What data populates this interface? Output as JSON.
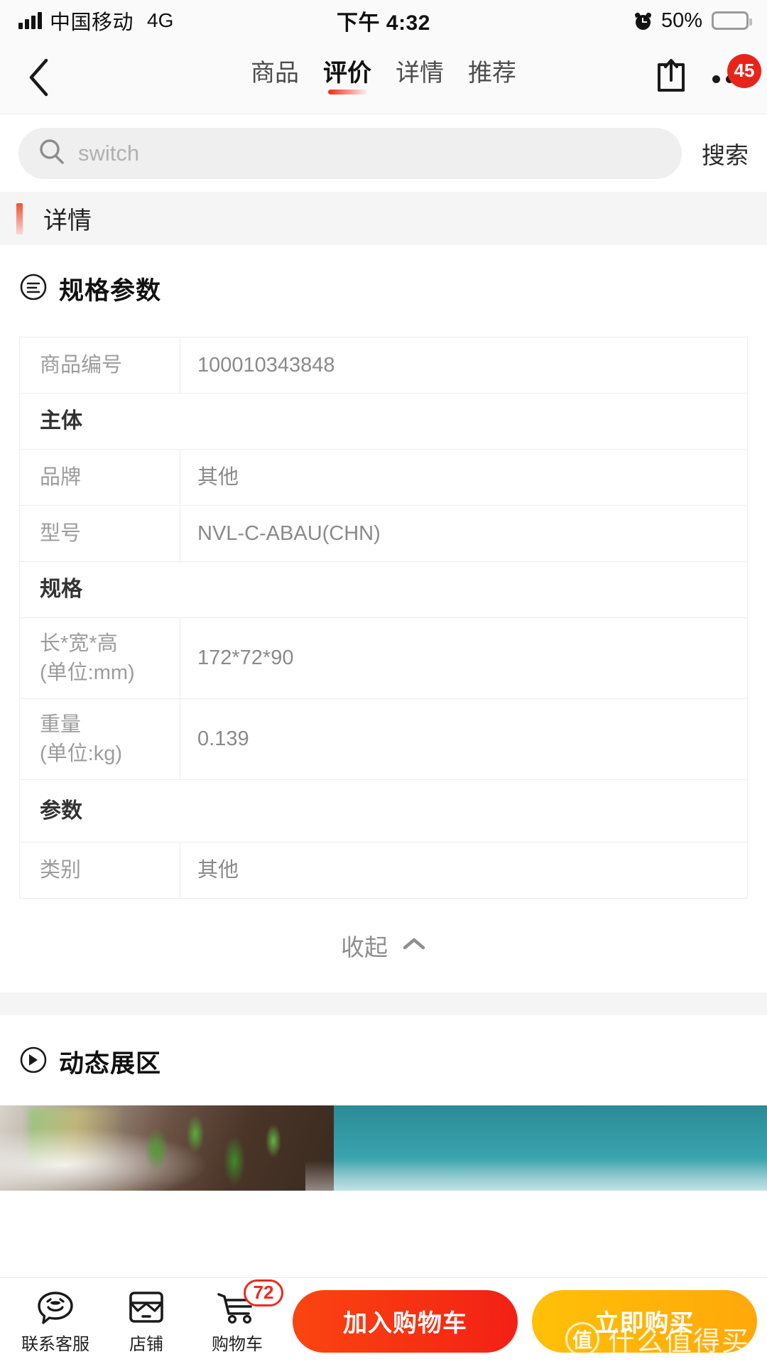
{
  "statusbar": {
    "carrier": "中国移动",
    "network": "4G",
    "time": "下午 4:32",
    "battery_percent": "50%",
    "battery_level": 50,
    "signal_icon": "signal-bars-icon",
    "alarm_icon": "alarm-clock-icon",
    "battery_icon": "battery-icon"
  },
  "navbar": {
    "back_icon": "back-chevron-icon",
    "share_icon": "share-icon",
    "more_icon": "more-dots-icon",
    "more_badge": "45",
    "tabs": [
      {
        "label": "商品",
        "active": false
      },
      {
        "label": "评价",
        "active": true
      },
      {
        "label": "详情",
        "active": false
      },
      {
        "label": "推荐",
        "active": false
      }
    ]
  },
  "search": {
    "icon": "search-icon",
    "placeholder": "switch",
    "value": "",
    "button_label": "搜索"
  },
  "detail_band": {
    "label": "详情"
  },
  "spec_section": {
    "icon": "spec-list-circle-icon",
    "title": "规格参数",
    "rows": [
      {
        "type": "item",
        "key": "商品编号",
        "value": "100010343848"
      },
      {
        "type": "group",
        "key": "主体",
        "value": ""
      },
      {
        "type": "item",
        "key": "品牌",
        "value": "其他"
      },
      {
        "type": "item",
        "key": "型号",
        "value": "NVL-C-ABAU(CHN)"
      },
      {
        "type": "group",
        "key": "规格",
        "value": ""
      },
      {
        "type": "item",
        "key": "长*宽*高\n(单位:mm)",
        "value": "172*72*90"
      },
      {
        "type": "item",
        "key": "重量\n(单位:kg)",
        "value": "0.139"
      },
      {
        "type": "group",
        "key": "参数",
        "value": ""
      },
      {
        "type": "item",
        "key": "类别",
        "value": "其他"
      }
    ],
    "collapse_label": "收起",
    "collapse_icon": "chevron-up-icon"
  },
  "dynamic_section": {
    "icon": "play-circle-icon",
    "title": "动态展区"
  },
  "bottombar": {
    "items": [
      {
        "label": "联系客服",
        "icon": "customer-service-smiley-icon",
        "badge": ""
      },
      {
        "label": "店铺",
        "icon": "shop-icon",
        "badge": ""
      },
      {
        "label": "购物车",
        "icon": "shopping-cart-icon",
        "badge": "72"
      }
    ],
    "add_to_cart_label": "加入购物车",
    "buy_now_label": "立即购买"
  },
  "watermark": {
    "logo_char": "值",
    "text": "什么值得买"
  },
  "colors": {
    "accent_red": "#f02b18",
    "badge_red": "#e8241a",
    "cart_button": "#f32015",
    "buy_button": "#ffb005",
    "muted_text": "#9c9c9c"
  }
}
